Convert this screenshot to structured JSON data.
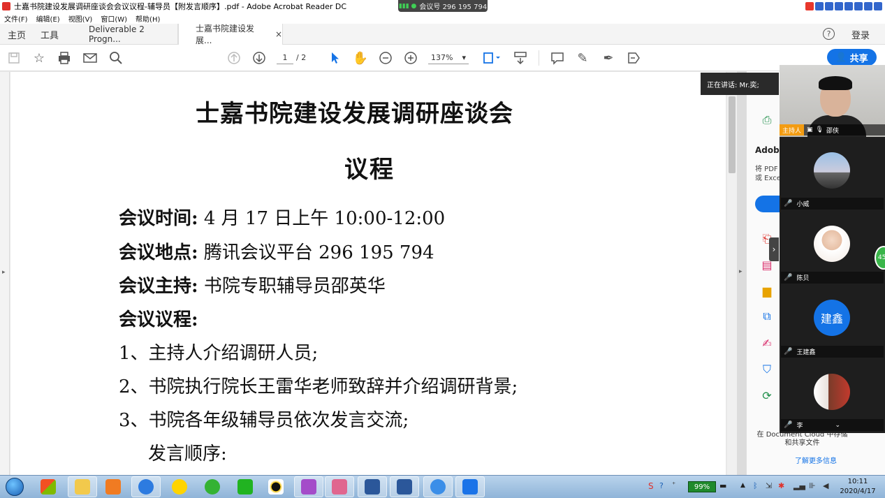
{
  "window": {
    "title": "士嘉书院建设发展调研座谈会会议议程-辅导员【附发言顺序】.pdf - Adobe Acrobat Reader DC",
    "meeting_id_label": "会议号 296 195 794"
  },
  "menu": [
    "文件(F)",
    "编辑(E)",
    "视图(V)",
    "窗口(W)",
    "帮助(H)"
  ],
  "tabs": {
    "home": "主页",
    "tools": "工具",
    "doc_tabs": [
      {
        "label": "Deliverable 2 Progn..."
      },
      {
        "label": "士嘉书院建设发展...",
        "close": "×"
      }
    ],
    "help": "?",
    "login": "登录"
  },
  "toolbar": {
    "page_current": "1",
    "page_total": "/ 2",
    "zoom": "137%",
    "share": "共享"
  },
  "document": {
    "title": "士嘉书院建设发展调研座谈会",
    "subtitle": "议程",
    "time_label": "会议时间:",
    "time_value": "4 月 17 日上午 10:00-12:00",
    "place_label": "会议地点:",
    "place_value": "腾讯会议平台 296 195 794",
    "host_label": "会议主持:",
    "host_value": "书院专职辅导员邵英华",
    "agenda_label": "会议议程:",
    "agenda": [
      "1、主持人介绍调研人员;",
      "2、书院执行院长王雷华老师致辞并介绍调研背景;",
      "3、书院各年级辅导员依次发言交流;"
    ],
    "speaking_order": "发言顺序:"
  },
  "right_panel": {
    "adobe_title": "Adobe",
    "desc_line1": "将 PDF",
    "desc_line2": "或 Exce",
    "promo": "在 Document Cloud 中存储和共享文件",
    "promo_link": "了解更多信息"
  },
  "meeting": {
    "speaking": "正在讲话: Mr.奕;",
    "host_tag": "主持人",
    "host_name": "邵侠",
    "participants": [
      {
        "name": "小威"
      },
      {
        "name": "陈贝"
      },
      {
        "name": "王建鑫",
        "avatar_text": "建鑫"
      },
      {
        "name": "李"
      }
    ],
    "side_badge": "45"
  },
  "taskbar": {
    "battery": "99%",
    "time": "10:11",
    "date": "2020/4/17"
  }
}
